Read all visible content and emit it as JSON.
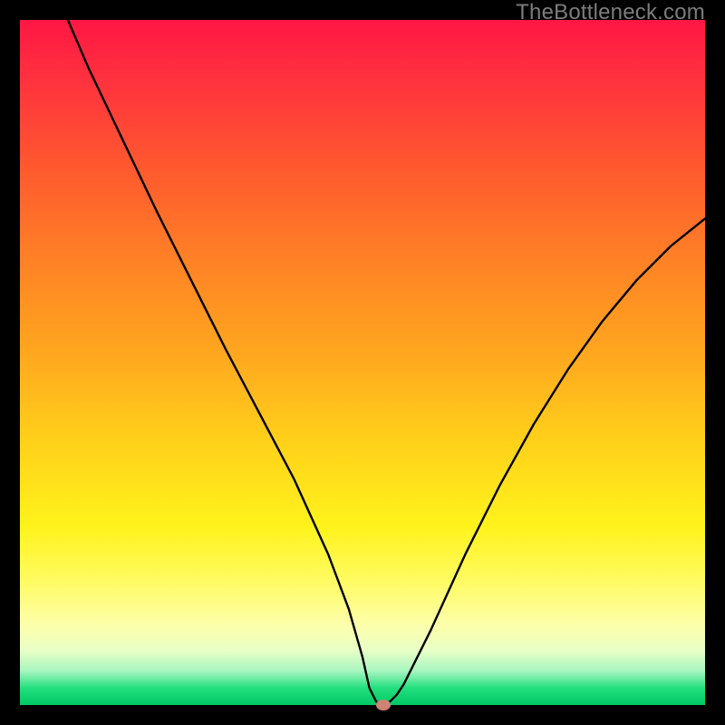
{
  "watermark": "TheBottleneck.com",
  "chart_data": {
    "type": "line",
    "title": "",
    "xlabel": "",
    "ylabel": "",
    "xlim": [
      0,
      100
    ],
    "ylim": [
      0,
      100
    ],
    "grid": false,
    "series": [
      {
        "name": "bottleneck-curve",
        "x": [
          7,
          10,
          15,
          20,
          25,
          30,
          35,
          40,
          45,
          48,
          50,
          51,
          52,
          53,
          54,
          55,
          56,
          60,
          65,
          70,
          75,
          80,
          85,
          90,
          95,
          100
        ],
        "values": [
          100,
          93,
          82.5,
          72,
          62,
          52,
          42.5,
          33,
          22,
          14,
          7,
          2.5,
          0.5,
          0,
          0.5,
          1.5,
          3,
          11,
          22,
          32,
          41,
          49,
          56,
          62,
          67,
          71
        ]
      }
    ],
    "annotations": [
      {
        "name": "min-marker",
        "x": 53,
        "y": 0,
        "color": "#cf8374"
      }
    ],
    "background_gradient_stops": [
      {
        "pos": 0.0,
        "color": "#ff1744"
      },
      {
        "pos": 0.22,
        "color": "#ff5a2e"
      },
      {
        "pos": 0.48,
        "color": "#ffa51f"
      },
      {
        "pos": 0.74,
        "color": "#fff31c"
      },
      {
        "pos": 0.92,
        "color": "#e9ffc6"
      },
      {
        "pos": 1.0,
        "color": "#00c864"
      }
    ]
  }
}
